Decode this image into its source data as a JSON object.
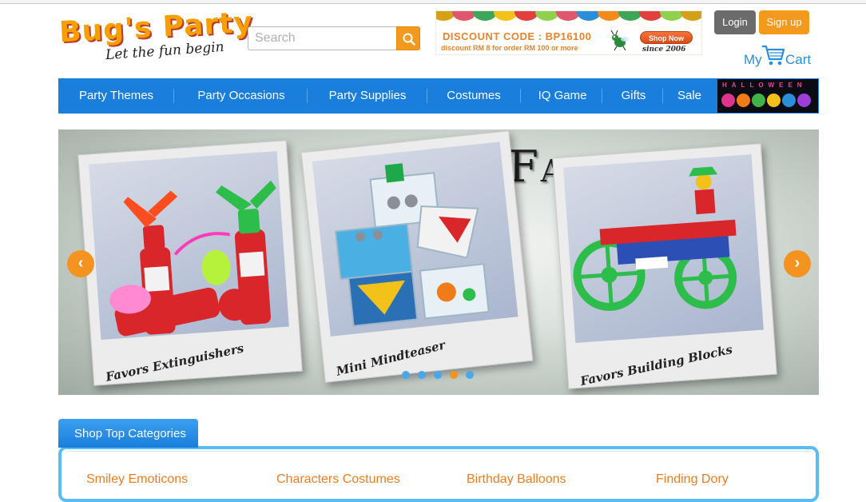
{
  "header": {
    "logo_title": "Bug's Party",
    "logo_tagline": "Let the fun begin",
    "search": {
      "placeholder": "Search"
    },
    "promo": {
      "code": "DISCOUNT CODE : BP16100",
      "subtext": "discount RM 8 for order RM 100 or more",
      "shop_now": "Shop Now",
      "since": "since 2006"
    },
    "login_label": "Login",
    "signup_label": "Sign up",
    "cart": {
      "my": "My",
      "label": "Cart"
    }
  },
  "nav": {
    "items": [
      {
        "label": "Party Themes"
      },
      {
        "label": "Party Occasions"
      },
      {
        "label": "Party Supplies"
      },
      {
        "label": "Costumes"
      },
      {
        "label": "IQ Game"
      },
      {
        "label": "Gifts"
      },
      {
        "label": "Sale"
      }
    ],
    "halloween_text": "HALLOWEEN"
  },
  "banner": {
    "title": "Party Favors",
    "captions": [
      "Favors Extinguishers",
      "Mini Mindteaser",
      "Favors Building Blocks"
    ],
    "prev": "‹",
    "next": "›",
    "dot_count": 5,
    "active_dot": 3
  },
  "categories": {
    "tab_label": "Shop Top Categories",
    "items": [
      "Smiley Emoticons",
      "Characters Costumes",
      "Birthday Balloons",
      "Finding Dory"
    ]
  },
  "colors": {
    "brand_blue": "#1a7fdc",
    "accent_orange": "#f39a1e",
    "link_orange": "#ee7d1e",
    "cart_blue": "#2a8ed9"
  }
}
